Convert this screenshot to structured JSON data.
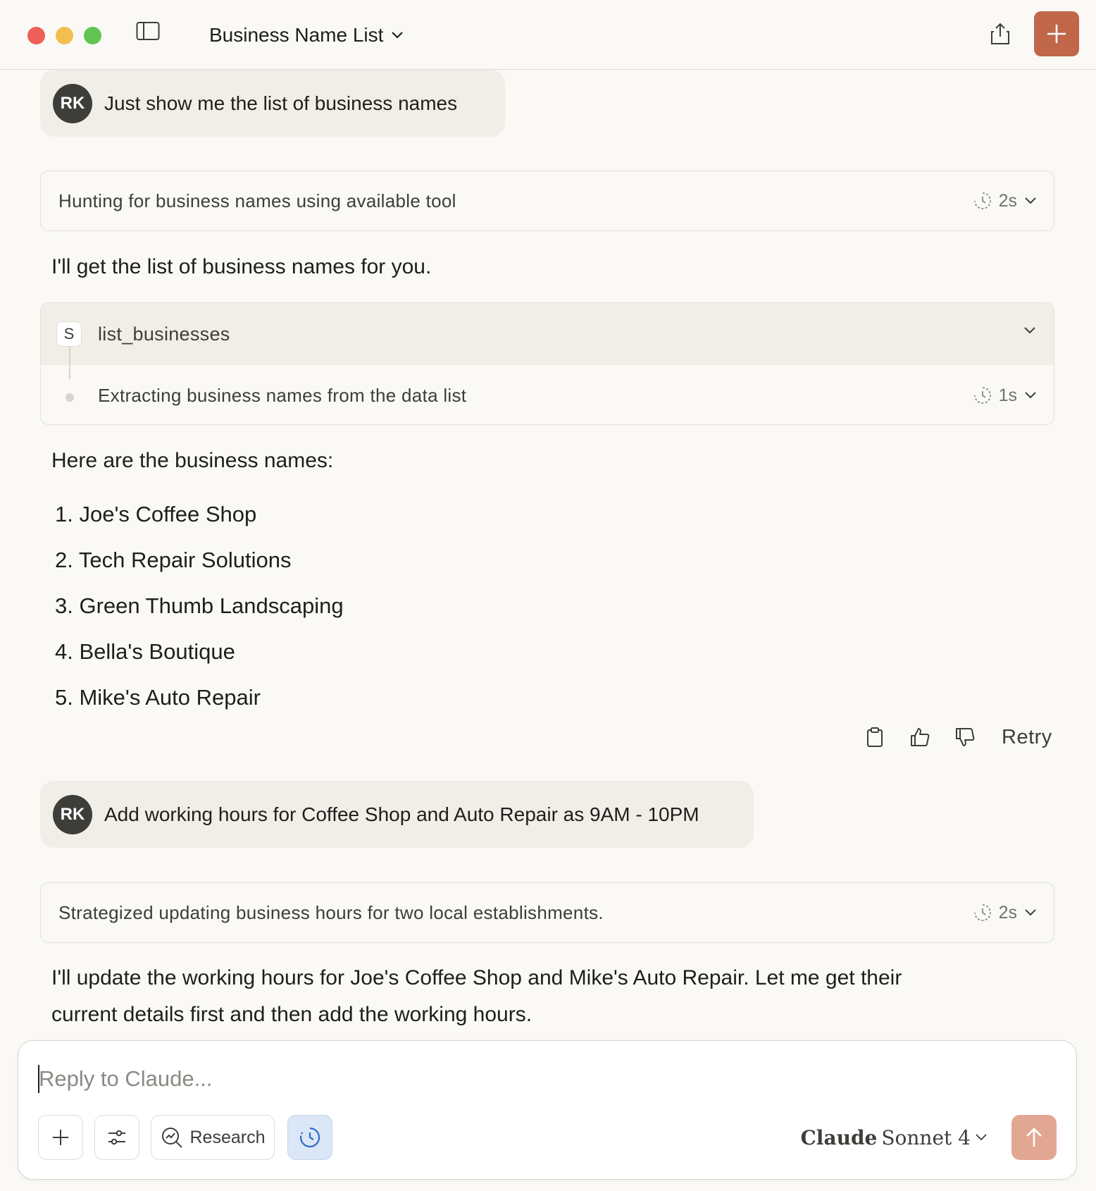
{
  "titlebar": {
    "title": "Business Name List"
  },
  "messages": {
    "user1": {
      "avatar": "RK",
      "text": "Just show me the list of business names"
    },
    "think1": {
      "text": "Hunting for business names using available tool",
      "duration": "2s"
    },
    "reply1": "I'll get the list of business names for you.",
    "tool": {
      "badge": "S",
      "name": "list_businesses",
      "sub_text": "Extracting business names from the data list",
      "sub_duration": "1s"
    },
    "intro": "Here are the business names:",
    "businesses": [
      "1. Joe's Coffee Shop",
      "2. Tech Repair Solutions",
      "3. Green Thumb Landscaping",
      "4. Bella's Boutique",
      "5. Mike's Auto Repair"
    ],
    "actions": {
      "retry_label": "Retry"
    },
    "user2": {
      "avatar": "RK",
      "text": "Add working hours for Coffee Shop and Auto Repair as 9AM - 10PM"
    },
    "think2": {
      "text": "Strategized updating business hours for two local establishments.",
      "duration": "2s"
    },
    "reply2_line1": "I'll update the working hours for Joe's Coffee Shop and Mike's Auto Repair. Let me get their",
    "reply2_line2": "current details first and then add the working hours."
  },
  "composer": {
    "placeholder": "Reply to Claude...",
    "research_label": "Research",
    "model_name_bold": "Claude",
    "model_name": "Sonnet 4"
  },
  "colors": {
    "accent": "#c0674a",
    "send_disabled": "#e2a793",
    "background": "#faf9f5",
    "bubble": "#f0eee6"
  }
}
